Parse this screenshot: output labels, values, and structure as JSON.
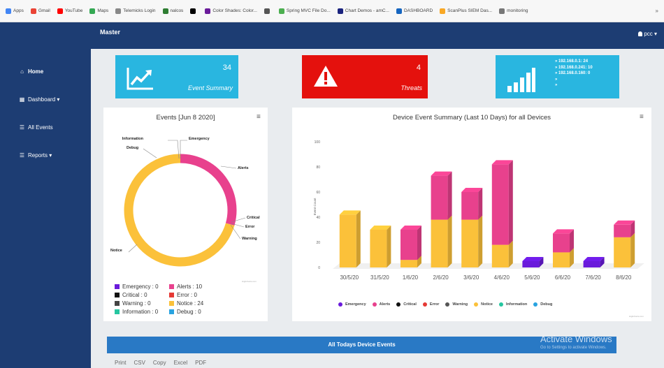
{
  "bookmarks": [
    {
      "label": "Apps",
      "color": "#4285f4"
    },
    {
      "label": "Gmail",
      "color": "#ea4335"
    },
    {
      "label": "YouTube",
      "color": "#ff0000"
    },
    {
      "label": "Maps",
      "color": "#34a853"
    },
    {
      "label": "Telemicks Login",
      "color": "#888888"
    },
    {
      "label": "nalcos",
      "color": "#2e7d32"
    },
    {
      "label": "",
      "color": "#000000"
    },
    {
      "label": "Color Shades: Color...",
      "color": "#6a1b9a"
    },
    {
      "label": "",
      "color": "#555555"
    },
    {
      "label": "Spring MVC File Do...",
      "color": "#4caf50"
    },
    {
      "label": "Chart Demos - amC...",
      "color": "#1a237e"
    },
    {
      "label": "DASHBOARD",
      "color": "#1565c0"
    },
    {
      "label": "ScanPlus SIEM Das...",
      "color": "#f9a825"
    },
    {
      "label": "monitoring",
      "color": "#777777"
    }
  ],
  "bookmarks_more": "»",
  "header": {
    "brand": "Master",
    "user": "pcc ▾"
  },
  "sidebar": {
    "items": [
      {
        "label": "Home",
        "glyph": "⌂"
      },
      {
        "label": "Dashboard ▾",
        "glyph": "▦"
      },
      {
        "label": "All Events",
        "glyph": "☰"
      },
      {
        "label": "Reports ▾",
        "glyph": "☰"
      }
    ]
  },
  "tiles": {
    "events": {
      "count": "34",
      "label": "Event Summary",
      "icon": "trend-up-icon"
    },
    "threats": {
      "count": "4",
      "label": "Threats",
      "icon": "warning-icon"
    },
    "devices": {
      "icon": "signal-bars-icon",
      "lines": [
        "» 192.168.0.1: 24",
        "» 192.168.0.241: 10",
        "» 192.168.0.160: 0",
        "»",
        "»"
      ]
    }
  },
  "donut": {
    "title": "Events [Jun 8 2020]",
    "credit": "Highcharts.com",
    "menu_icon": "hamburger-icon",
    "legend": [
      {
        "label": "Emergency : 0",
        "color": "#6a1bdb"
      },
      {
        "label": "Alerts : 10",
        "color": "#e8418d"
      },
      {
        "label": "Critical : 0",
        "color": "#111111"
      },
      {
        "label": "Error : 0",
        "color": "#e53935"
      },
      {
        "label": "Warning : 0",
        "color": "#444444"
      },
      {
        "label": "Notice : 24",
        "color": "#fbc13a"
      },
      {
        "label": "Information : 0",
        "color": "#26c6a0"
      },
      {
        "label": "Debug : 0",
        "color": "#29a3e0"
      }
    ]
  },
  "chart_data": [
    {
      "type": "pie",
      "title": "Events [Jun 8 2020]",
      "slices": [
        {
          "name": "Emergency",
          "value": 0,
          "color": "#6a1bdb"
        },
        {
          "name": "Alerts",
          "value": 10,
          "color": "#e8418d"
        },
        {
          "name": "Critical",
          "value": 0,
          "color": "#111111"
        },
        {
          "name": "Error",
          "value": 0,
          "color": "#e53935"
        },
        {
          "name": "Warning",
          "value": 0,
          "color": "#444444"
        },
        {
          "name": "Notice",
          "value": 24,
          "color": "#fbc13a"
        },
        {
          "name": "Information",
          "value": 0,
          "color": "#26c6a0"
        },
        {
          "name": "Debug",
          "value": 0,
          "color": "#29a3e0"
        }
      ]
    },
    {
      "type": "bar",
      "stacked": true,
      "title": "Device Event Summary (Last 10 Days) for all Devices",
      "ylabel": "Event Count",
      "ylim": [
        0,
        100
      ],
      "yticks": [
        0,
        20,
        40,
        60,
        80,
        100
      ],
      "categories": [
        "30/5/20",
        "31/5/20",
        "1/6/20",
        "2/6/20",
        "3/6/20",
        "4/6/20",
        "5/6/20",
        "6/6/20",
        "7/6/20",
        "8/6/20"
      ],
      "series": [
        {
          "name": "Notice",
          "color": "#fbc13a",
          "values": [
            42,
            30,
            6,
            38,
            38,
            18,
            0,
            12,
            0,
            24
          ]
        },
        {
          "name": "Alerts",
          "color": "#e8418d",
          "values": [
            0,
            0,
            24,
            35,
            22,
            64,
            0,
            15,
            0,
            10
          ]
        },
        {
          "name": "Emergency",
          "color": "#6a1bdb",
          "values": [
            0,
            0,
            0,
            0,
            0,
            0,
            5,
            0,
            5,
            0
          ]
        }
      ],
      "credit": "Highcharts.com",
      "legend": [
        {
          "label": "Emergency",
          "color": "#6a1bdb"
        },
        {
          "label": "Alerts",
          "color": "#e8418d"
        },
        {
          "label": "Critical",
          "color": "#111111"
        },
        {
          "label": "Error",
          "color": "#e53935"
        },
        {
          "label": "Warning",
          "color": "#555555"
        },
        {
          "label": "Notice",
          "color": "#fbc13a"
        },
        {
          "label": "Information",
          "color": "#26c6a0"
        },
        {
          "label": "Debug",
          "color": "#29a3e0"
        }
      ]
    }
  ],
  "table": {
    "title": "All Todays Device Events",
    "buttons": [
      "Print",
      "CSV",
      "Copy",
      "Excel",
      "PDF"
    ]
  },
  "watermark": {
    "title": "Activate Windows",
    "sub": "Go to Settings to activate Windows."
  }
}
